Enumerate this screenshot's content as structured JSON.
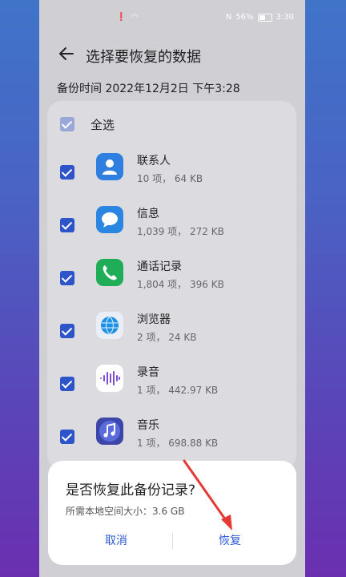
{
  "status": {
    "left_icons": "! ≋",
    "battery": "56%",
    "time": "3:30",
    "nfc": "N"
  },
  "header": {
    "title": "选择要恢复的数据"
  },
  "backup": {
    "time_label": "备份时间 2022年12月2日 下午3:28"
  },
  "list": {
    "select_all": "全选",
    "items": [
      {
        "name": "联系人",
        "meta": "10 项， 64 KB",
        "icon": "contacts-icon"
      },
      {
        "name": "信息",
        "meta": "1,039 项， 272 KB",
        "icon": "messages-icon"
      },
      {
        "name": "通话记录",
        "meta": "1,804 项， 396 KB",
        "icon": "phone-icon"
      },
      {
        "name": "浏览器",
        "meta": "2 项， 24 KB",
        "icon": "browser-icon"
      },
      {
        "name": "录音",
        "meta": "1 项， 442.97 KB",
        "icon": "recorder-icon"
      },
      {
        "name": "音乐",
        "meta": "1 项， 698.88 KB",
        "icon": "music-icon"
      }
    ]
  },
  "dialog": {
    "title": "是否恢复此备份记录?",
    "subtitle": "所需本地空间大小：3.6 GB",
    "cancel": "取消",
    "confirm": "恢复"
  },
  "colors": {
    "accent": "#2d5bd6",
    "checkbox": "#2d55c9",
    "annotation": "#e53935"
  }
}
